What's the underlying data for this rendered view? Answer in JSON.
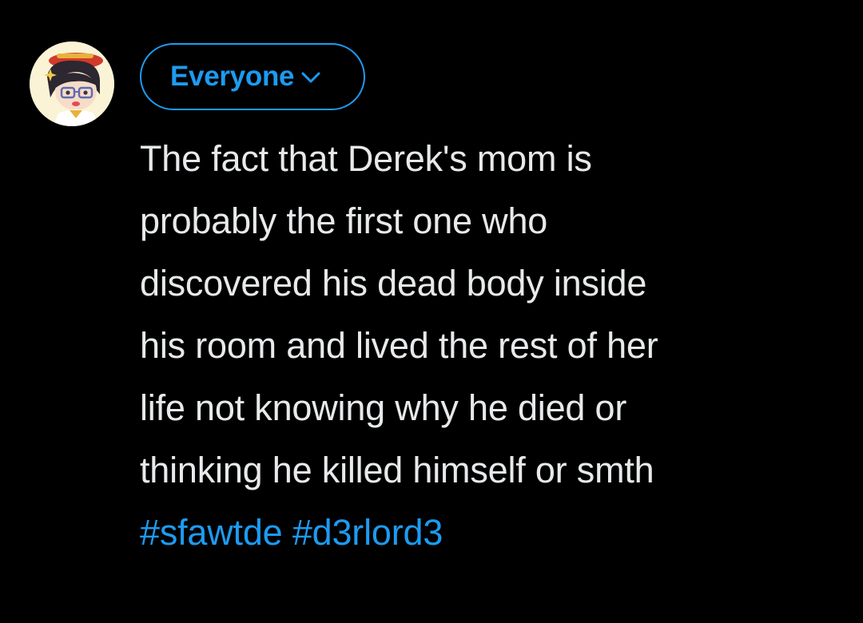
{
  "composer": {
    "audience": {
      "label": "Everyone"
    },
    "post": {
      "lines": [
        "The fact that Derek's mom is",
        "probably the first one who",
        "discovered his dead body inside",
        "his room and lived the rest of her",
        "life not knowing why he died or",
        "thinking he killed himself or smth"
      ],
      "hashtags": [
        "#sfawtde",
        "#d3rlord3"
      ]
    }
  },
  "colors": {
    "background": "#000000",
    "text": "#e7e9ea",
    "accent": "#1d9bf0"
  },
  "icons": {
    "audience_chevron": "chevron-down-icon",
    "avatar": "user-avatar"
  }
}
